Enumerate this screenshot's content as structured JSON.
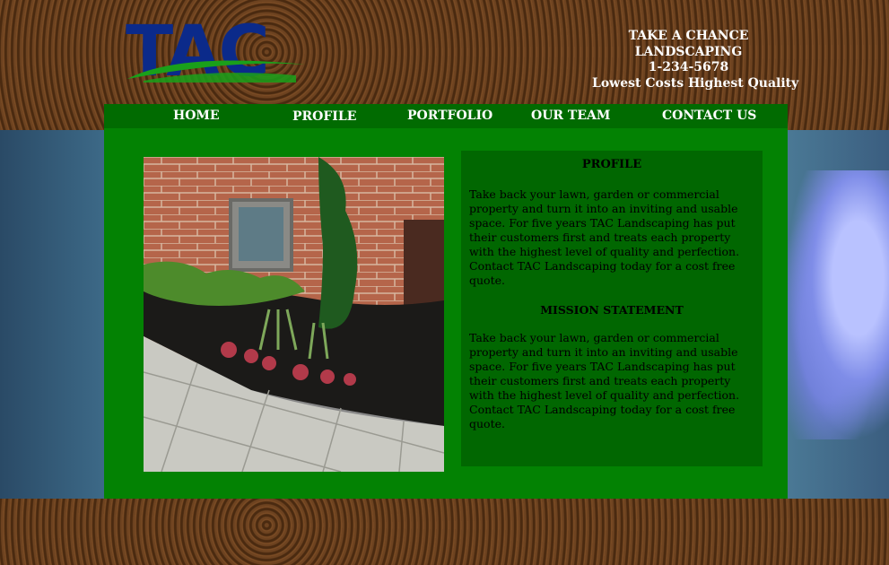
{
  "company": {
    "logo_text": "TAC",
    "name_line1": "TAKE A CHANCE",
    "name_line2": "LANDSCAPING",
    "phone": "1-234-5678",
    "tagline": "Lowest Costs Highest Quality"
  },
  "nav": {
    "items": [
      {
        "label": "HOME"
      },
      {
        "label": "PROFILE"
      },
      {
        "label": "PORTFOLIO"
      },
      {
        "label": "OUR TEAM"
      },
      {
        "label": "CONTACT US"
      }
    ]
  },
  "profile": {
    "title": "PROFILE",
    "body": "Take back your lawn, garden or commercial property and turn it into an inviting and usable space. For five years TAC Landscaping has put their customers first and treats each property with the highest level of quality and perfection. Contact TAC Landscaping today for a cost free quote.",
    "mission_title": "MISSION STATEMENT",
    "mission_body": "Take back your lawn, garden or commercial property and turn it into an inviting and usable space. For five years TAC Landscaping has put their customers first and treats each property with the highest level of quality and perfection. Contact TAC Landscaping today for a cost free quote."
  },
  "colors": {
    "main_green": "#038203",
    "nav_green": "#016b01",
    "logo_blue": "#0b2a8a",
    "logo_green": "#1aa01a"
  },
  "icons": {
    "logo": "tac-logo",
    "photo": "garden-photo"
  }
}
